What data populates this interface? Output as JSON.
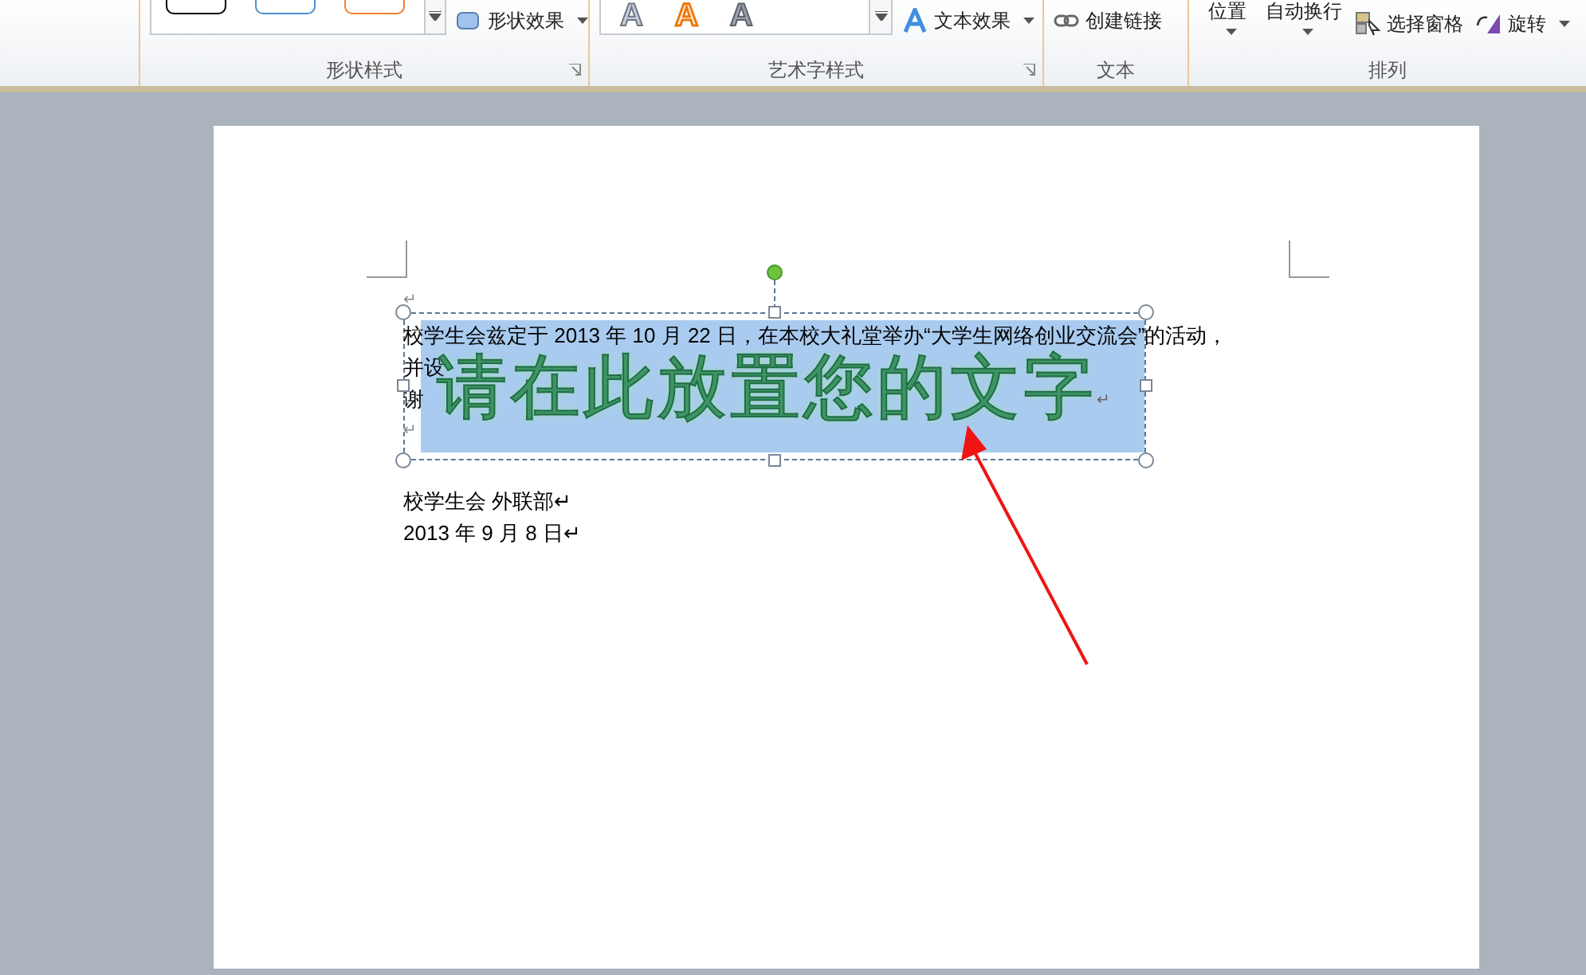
{
  "ribbon": {
    "groups": [
      {
        "label": "形状样式",
        "kind": "shape",
        "dialog_launcher": true,
        "buttons": [
          {
            "label": "形状效果",
            "dropdown": true
          }
        ]
      },
      {
        "label": "艺术字样式",
        "kind": "wordart",
        "dialog_launcher": true,
        "previews": [
          "A",
          "A",
          "A"
        ],
        "buttons": [
          {
            "label": "文本效果",
            "dropdown": true
          }
        ]
      },
      {
        "label": "文本",
        "kind": "text",
        "dialog_launcher": false,
        "buttons": [
          {
            "label": "创建链接",
            "dropdown": false
          }
        ]
      },
      {
        "label": "排列",
        "kind": "arrange",
        "dialog_launcher": false,
        "buttons": [
          {
            "label": "位置",
            "dropdown": true
          },
          {
            "label": "自动换行",
            "dropdown": true
          },
          {
            "label": "选择窗格",
            "dropdown": false
          },
          {
            "label": "旋转",
            "dropdown": true
          }
        ]
      }
    ]
  },
  "document": {
    "paragraphs": [
      {
        "kind": "mark",
        "lines": [
          "↵"
        ]
      },
      {
        "kind": "text",
        "lines": [
          "校学生会兹定于 2013 年 10 月 22 日，在本校大礼堂举办“大学生网络创业交流会”的活动，",
          "并设",
          "谢"
        ]
      },
      {
        "kind": "mark",
        "lines": [
          "↵"
        ]
      },
      {
        "kind": "text",
        "lines": [
          "校学生会  外联部↵",
          "2013 年 9 月 8 日↵"
        ]
      }
    ],
    "wordart": {
      "text": "请在此放置您的文字",
      "selected": true,
      "mark": "↵"
    }
  }
}
